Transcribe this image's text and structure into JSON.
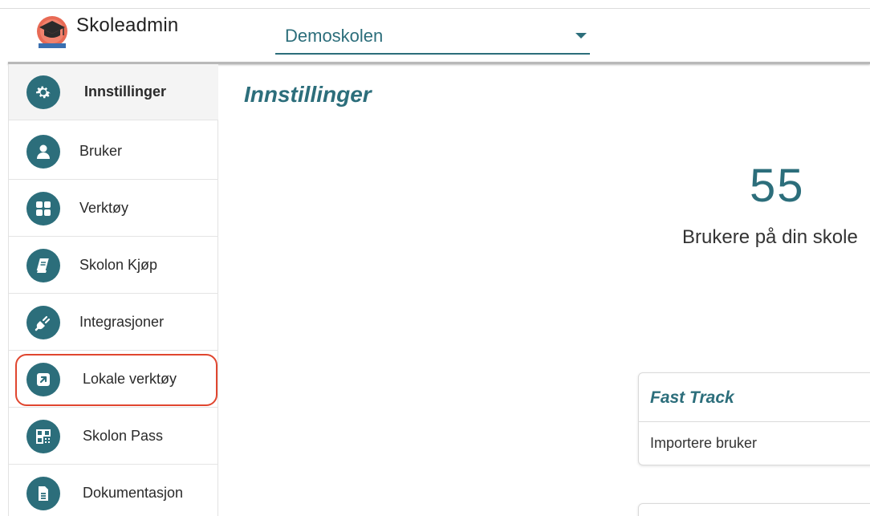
{
  "header": {
    "app_title": "Skoleadmin",
    "school_select_value": "Demoskolen"
  },
  "sidebar": {
    "items": [
      {
        "label": "Innstillinger",
        "icon": "gear-icon"
      },
      {
        "label": "Bruker",
        "icon": "user-icon"
      },
      {
        "label": "Verktøy",
        "icon": "grid-icon"
      },
      {
        "label": "Skolon Kjøp",
        "icon": "book-icon"
      },
      {
        "label": "Integrasjoner",
        "icon": "plug-icon"
      },
      {
        "label": "Lokale verktøy",
        "icon": "external-link-icon"
      },
      {
        "label": "Skolon Pass",
        "icon": "qr-code-icon"
      },
      {
        "label": "Dokumentasjon",
        "icon": "document-icon"
      }
    ]
  },
  "main": {
    "title": "Innstillinger",
    "stat_number": "55",
    "stat_label": "Brukere på din skole",
    "fast_track": {
      "title": "Fast Track",
      "link": "Importere bruker"
    }
  },
  "colors": {
    "accent": "#2c6e7b",
    "highlight": "#e0462f"
  }
}
